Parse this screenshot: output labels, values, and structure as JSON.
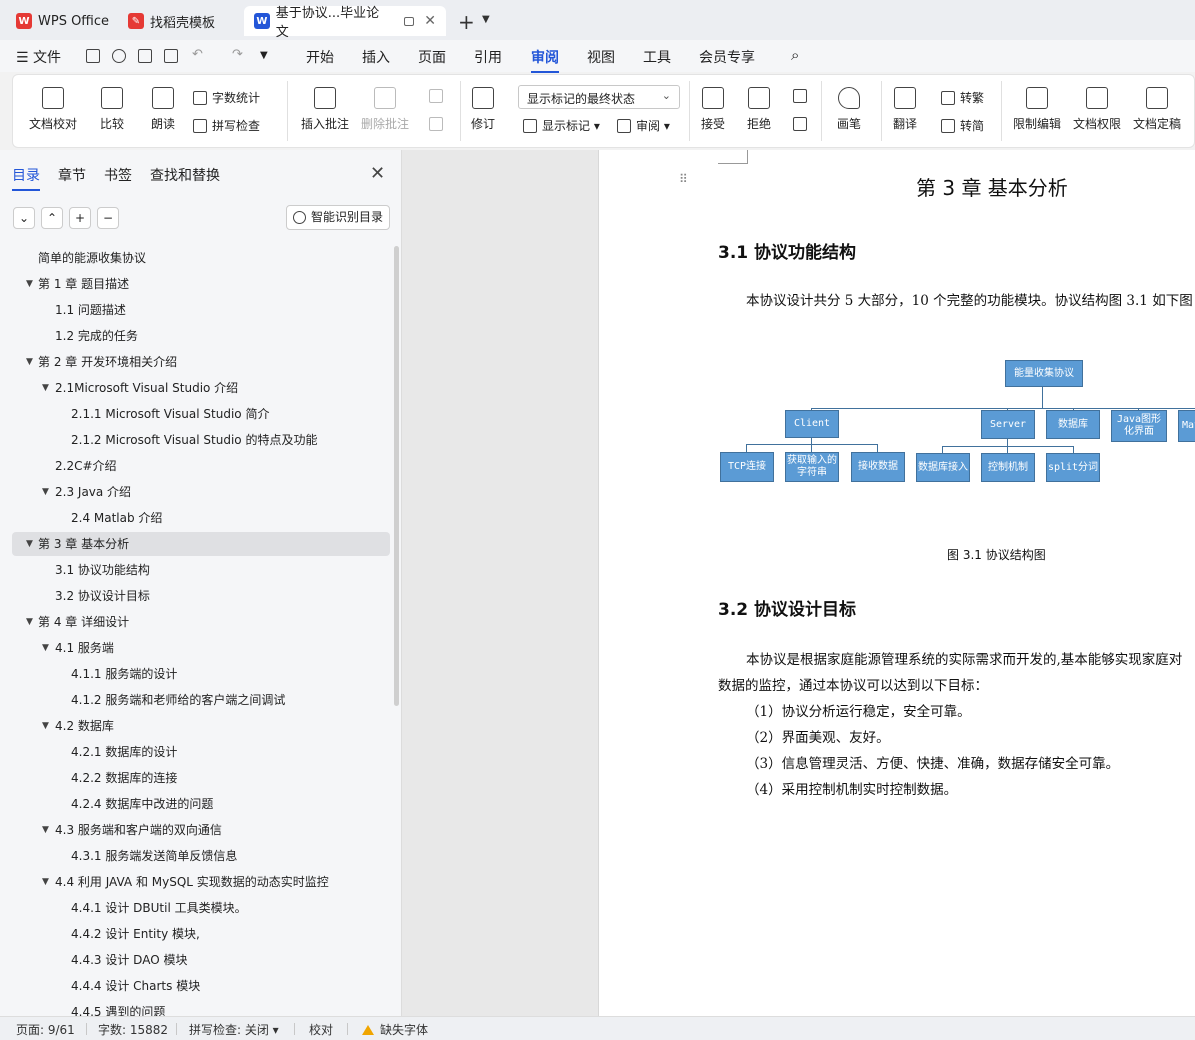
{
  "tabs": [
    {
      "label": "WPS Office",
      "color": "#e53935"
    },
    {
      "label": "找稻壳模板",
      "color": "#e53935"
    },
    {
      "label": "基于协议...毕业论文",
      "color": "#2356d8"
    }
  ],
  "menu": {
    "file": "文件",
    "items": [
      "开始",
      "插入",
      "页面",
      "引用",
      "审阅",
      "视图",
      "工具",
      "会员专享"
    ],
    "active": "审阅"
  },
  "ribbon": {
    "doc_check": "文档校对",
    "compare": "比较",
    "read_aloud": "朗读",
    "word_count": "字数统计",
    "spell_check": "拼写检查",
    "insert_comment": "插入批注",
    "delete_comment": "删除批注",
    "revise": "修订",
    "markup_state": "显示标记的最终状态",
    "show_markup": "显示标记",
    "review": "审阅",
    "accept": "接受",
    "reject": "拒绝",
    "ink": "画笔",
    "translate": "翻译",
    "to_traditional": "转繁",
    "to_simplified": "转简",
    "restrict_edit": "限制编辑",
    "doc_permission": "文档权限",
    "doc_finalize": "文档定稿"
  },
  "nav": {
    "tabs": [
      "目录",
      "章节",
      "书签",
      "查找和替换"
    ],
    "smart_toc": "智能识别目录",
    "toc": [
      {
        "label": "简单的能源收集协议",
        "level": 0,
        "arrow": false
      },
      {
        "label": "第 1 章  题目描述",
        "level": 0,
        "arrow": true
      },
      {
        "label": "1.1  问题描述",
        "level": 1,
        "arrow": false
      },
      {
        "label": "1.2  完成的任务",
        "level": 1,
        "arrow": false
      },
      {
        "label": "第 2 章   开发环境相关介绍",
        "level": 0,
        "arrow": true
      },
      {
        "label": "2.1Microsoft Visual Studio 介绍",
        "level": 1,
        "arrow": true
      },
      {
        "label": "2.1.1    Microsoft Visual Studio 简介",
        "level": 2,
        "arrow": false
      },
      {
        "label": "2.1.2 Microsoft Visual Studio 的特点及功能",
        "level": 2,
        "arrow": false
      },
      {
        "label": "2.2C#介绍",
        "level": 1,
        "arrow": false
      },
      {
        "label": "2.3 Java 介绍",
        "level": 1,
        "arrow": true
      },
      {
        "label": "2.4 Matlab 介绍",
        "level": 2,
        "arrow": false
      },
      {
        "label": "第 3 章  基本分析",
        "level": 0,
        "arrow": true,
        "selected": true
      },
      {
        "label": "3.1  协议功能结构",
        "level": 1,
        "arrow": false
      },
      {
        "label": "3.2  协议设计目标",
        "level": 1,
        "arrow": false
      },
      {
        "label": "第 4 章  详细设计",
        "level": 0,
        "arrow": true
      },
      {
        "label": "4.1 服务端",
        "level": 1,
        "arrow": true
      },
      {
        "label": "4.1.1  服务端的设计",
        "level": 2,
        "arrow": false
      },
      {
        "label": "4.1.2 服务端和老师给的客户端之间调试",
        "level": 2,
        "arrow": false
      },
      {
        "label": "4.2  数据库",
        "level": 1,
        "arrow": true
      },
      {
        "label": "4.2.1  数据库的设计",
        "level": 2,
        "arrow": false
      },
      {
        "label": "4.2.2  数据库的连接",
        "level": 2,
        "arrow": false
      },
      {
        "label": "4.2.4  数据库中改进的问题",
        "level": 2,
        "arrow": false
      },
      {
        "label": "4.3 服务端和客户端的双向通信",
        "level": 1,
        "arrow": true
      },
      {
        "label": "4.3.1 服务端发送简单反馈信息",
        "level": 2,
        "arrow": false
      },
      {
        "label": "4.4 利用 JAVA 和 MySQL 实现数据的动态实时监控",
        "level": 1,
        "arrow": true
      },
      {
        "label": "4.4.1 设计 DBUtil 工具类模块。",
        "level": 2,
        "arrow": false
      },
      {
        "label": "4.4.2 设计 Entity 模块,",
        "level": 2,
        "arrow": false
      },
      {
        "label": "4.4.3 设计 DAO 模块",
        "level": 2,
        "arrow": false
      },
      {
        "label": "4.4.4 设计 Charts 模块",
        "level": 2,
        "arrow": false
      },
      {
        "label": "4.4.5 遇到的问题",
        "level": 2,
        "arrow": false
      }
    ]
  },
  "doc": {
    "chapter_title": "第 3 章  基本分析",
    "sec1_title": "3.1  协议功能结构",
    "sec1_para": "本协议设计共分 5 大部分，10 个完整的功能模块。协议结构图 3.1 如下图",
    "figure": {
      "root": "能量收集协议",
      "level1": [
        "Client",
        "Server",
        "数据库",
        "Java图形化界面",
        "Mat"
      ],
      "client_children": [
        "TCP连接",
        "获取输入的字符串",
        "接收数据"
      ],
      "server_children": [
        "数据库接入",
        "控制机制",
        "split分词"
      ],
      "caption": "图 3.1 协议结构图"
    },
    "sec2_title": "3.2  协议设计目标",
    "sec2_para1": "本协议是根据家庭能源管理系统的实际需求而开发的,基本能够实现家庭对",
    "sec2_para2": "数据的监控，通过本协议可以达到以下目标：",
    "goals": [
      "（1）协议分析运行稳定，安全可靠。",
      "（2）界面美观、友好。",
      "（3）信息管理灵活、方便、快捷、准确，数据存储安全可靠。",
      "（4）采用控制机制实时控制数据。"
    ]
  },
  "status": {
    "page": "页面: 9/61",
    "words": "字数: 15882",
    "spell": "拼写检查: 关闭",
    "proof": "校对",
    "missing_font": "缺失字体"
  }
}
